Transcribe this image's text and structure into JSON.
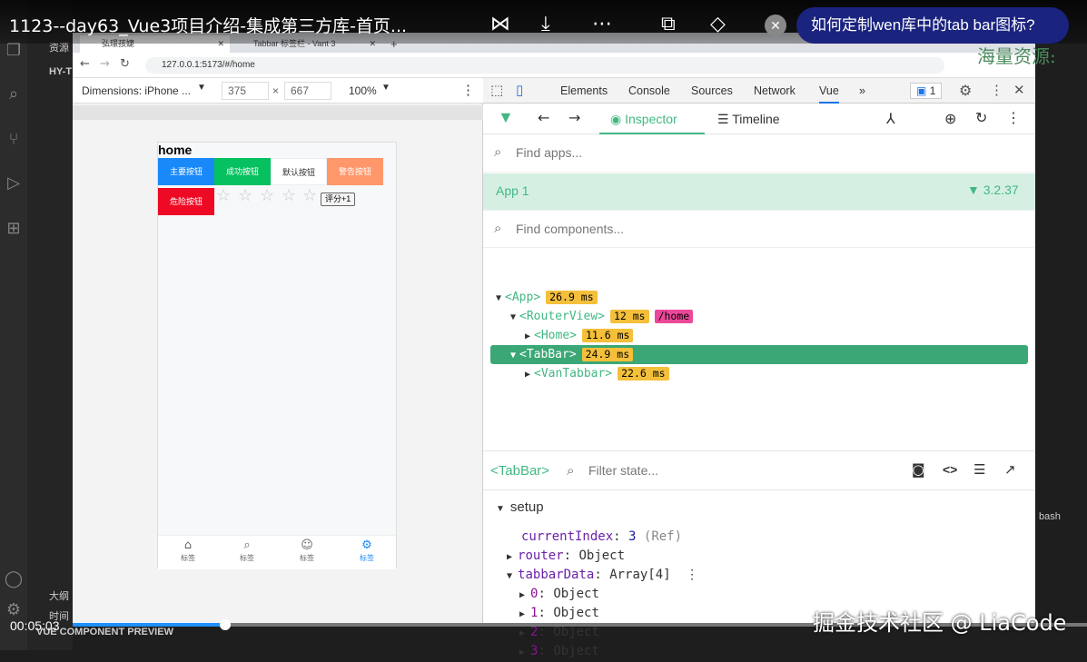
{
  "video": {
    "title": "1123--day63_Vue3项目介绍-集成第三方库-首页...",
    "question": "如何定制wen库中的tab bar图标?",
    "time": "00:05:03",
    "progress": 0.15,
    "watermark": "掘金技术社区 @ LiaCode",
    "side_watermark": "海量资源:"
  },
  "browser": {
    "tabs": [
      {
        "label": "弘璟孩婕"
      },
      {
        "label": "Tabbar 标签栏 - Vant 3"
      }
    ],
    "url": "127.0.0.1:5173/#/home"
  },
  "device": {
    "dimensions_label": "Dimensions: iPhone ...",
    "width": "375",
    "height": "667",
    "zoom": "100%",
    "times": "×"
  },
  "app": {
    "title": "home",
    "buttons": [
      {
        "label": "主要按钮",
        "color": "#1989fa"
      },
      {
        "label": "成功按钮",
        "color": "#07c160"
      },
      {
        "label": "默认按钮",
        "color": "#ffffff"
      },
      {
        "label": "警告按钮",
        "color": "#ff976a"
      },
      {
        "label": "危险按钮",
        "color": "#ee0a24"
      }
    ],
    "rate_button": "评分+1",
    "stars": 5,
    "tabbar": [
      {
        "icon": "home-icon",
        "label": "标签"
      },
      {
        "icon": "search-icon",
        "label": "标签"
      },
      {
        "icon": "friends-icon",
        "label": "标签"
      },
      {
        "icon": "setting-icon",
        "label": "标签",
        "active": true
      }
    ]
  },
  "devtools": {
    "tabs": [
      "Elements",
      "Console",
      "Sources",
      "Network",
      "Vue",
      "»"
    ],
    "issues": "1",
    "vue_tabs": {
      "inspector": "Inspector",
      "timeline": "Timeline"
    },
    "find_apps": "Find apps...",
    "app_name": "App 1",
    "vue_version": "3.2.37",
    "find_components": "Find components...",
    "tree": [
      {
        "name": "<App>",
        "time": "26.9 ms"
      },
      {
        "name": "<RouterView>",
        "time": "12 ms",
        "route": "/home"
      },
      {
        "name": "<Home>",
        "time": "11.6 ms"
      },
      {
        "name": "<TabBar>",
        "time": "24.9 ms",
        "selected": true
      },
      {
        "name": "<VanTabbar>",
        "time": "22.6 ms"
      }
    ],
    "state_component": "<TabBar>",
    "filter_state": "Filter state...",
    "section": "setup",
    "props": {
      "currentIndex_key": "currentIndex",
      "currentIndex_val": "3",
      "currentIndex_ref": "(Ref)",
      "router_key": "router",
      "router_val": "Object",
      "tabbarData_key": "tabbarData",
      "tabbarData_val": "Array[4]",
      "items": [
        {
          "key": "0",
          "val": "Object"
        },
        {
          "key": "1",
          "val": "Object"
        },
        {
          "key": "2",
          "val": "Object"
        },
        {
          "key": "3",
          "val": "Object"
        }
      ]
    }
  },
  "vscode": {
    "explorer_title": "HY-T",
    "res_label": "资源",
    "outline": "大纲",
    "timeline": "时间",
    "preview": "VUE COMPONENT PREVIEW",
    "terminal": "bash"
  }
}
